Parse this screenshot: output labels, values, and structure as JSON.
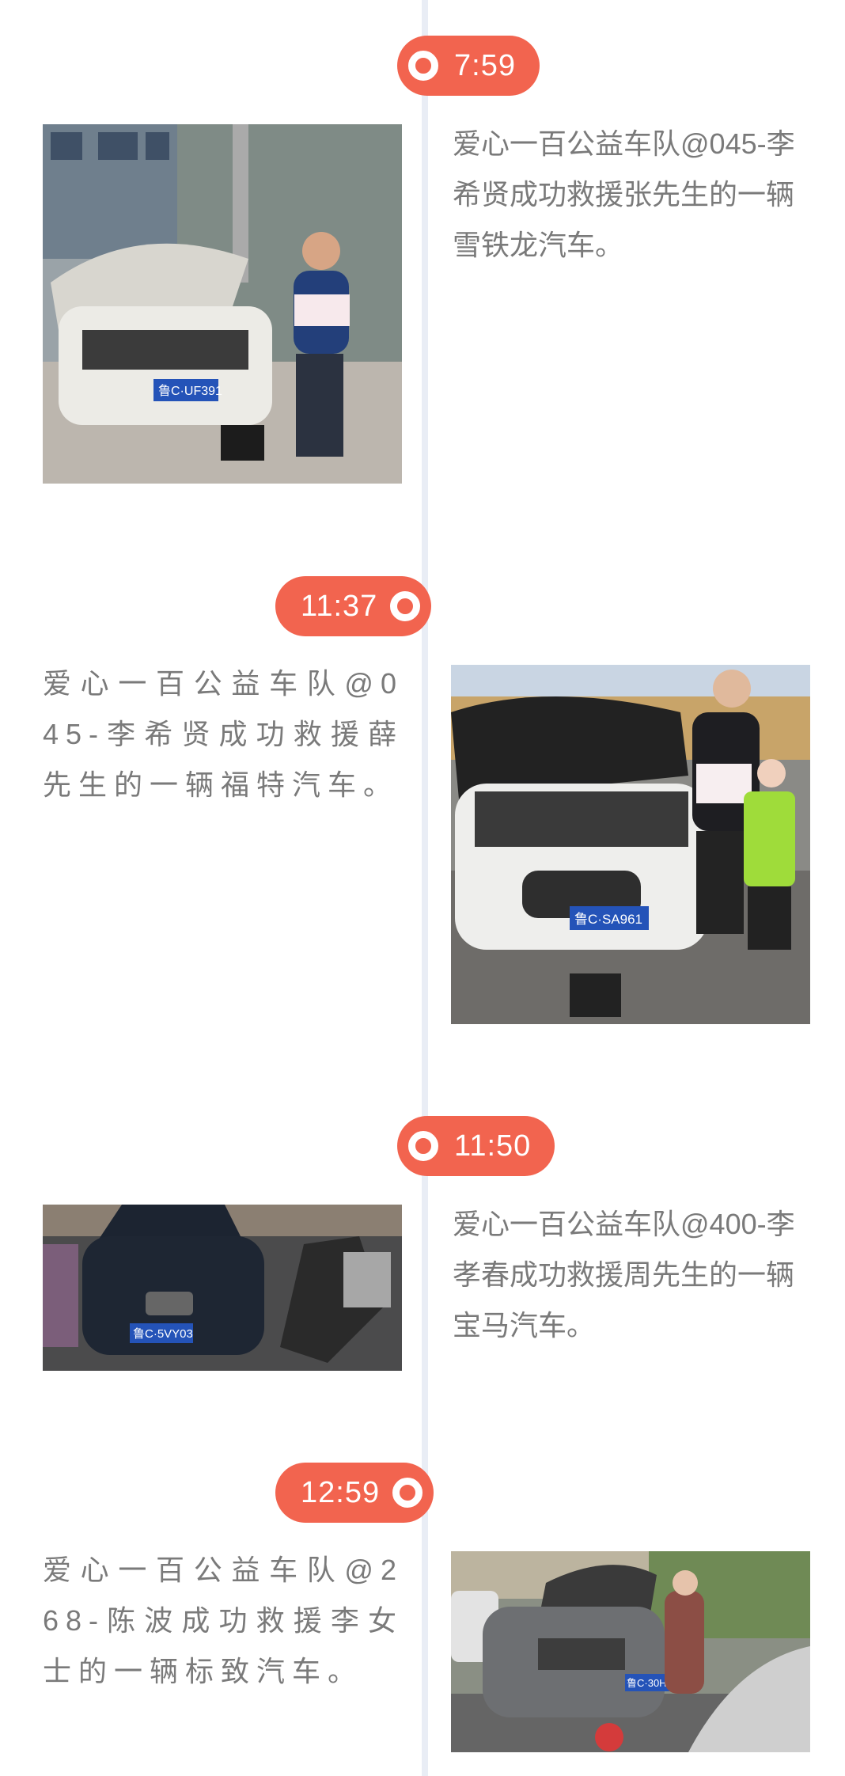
{
  "timeline": [
    {
      "time": "7:59",
      "text": "爱心一百公益车队@045-李希贤成功救援张先生的一辆雪铁龙汽车。",
      "photo": {
        "description_icon": "car-rescue-photo",
        "plate": "鲁C·UF391"
      }
    },
    {
      "time": "11:37",
      "text": "爱心一百公益车队@045-李希贤成功救援薛先生的一辆福特汽车。",
      "photo": {
        "description_icon": "car-rescue-photo",
        "plate": "鲁C·SA961"
      }
    },
    {
      "time": "11:50",
      "text": "爱心一百公益车队@400-李孝春成功救援周先生的一辆宝马汽车。",
      "photo": {
        "description_icon": "car-rescue-photo",
        "plate": "鲁C·5VY03"
      }
    },
    {
      "time": "12:59",
      "text": "爱心一百公益车队@268-陈波成功救援李女士的一辆标致汽车。",
      "photo": {
        "description_icon": "car-rescue-photo",
        "plate": "鲁C·30H75"
      }
    }
  ],
  "colors": {
    "accent": "#f2644f",
    "timeline_line": "#e9edf5",
    "caption_text": "#7a7a7a"
  }
}
